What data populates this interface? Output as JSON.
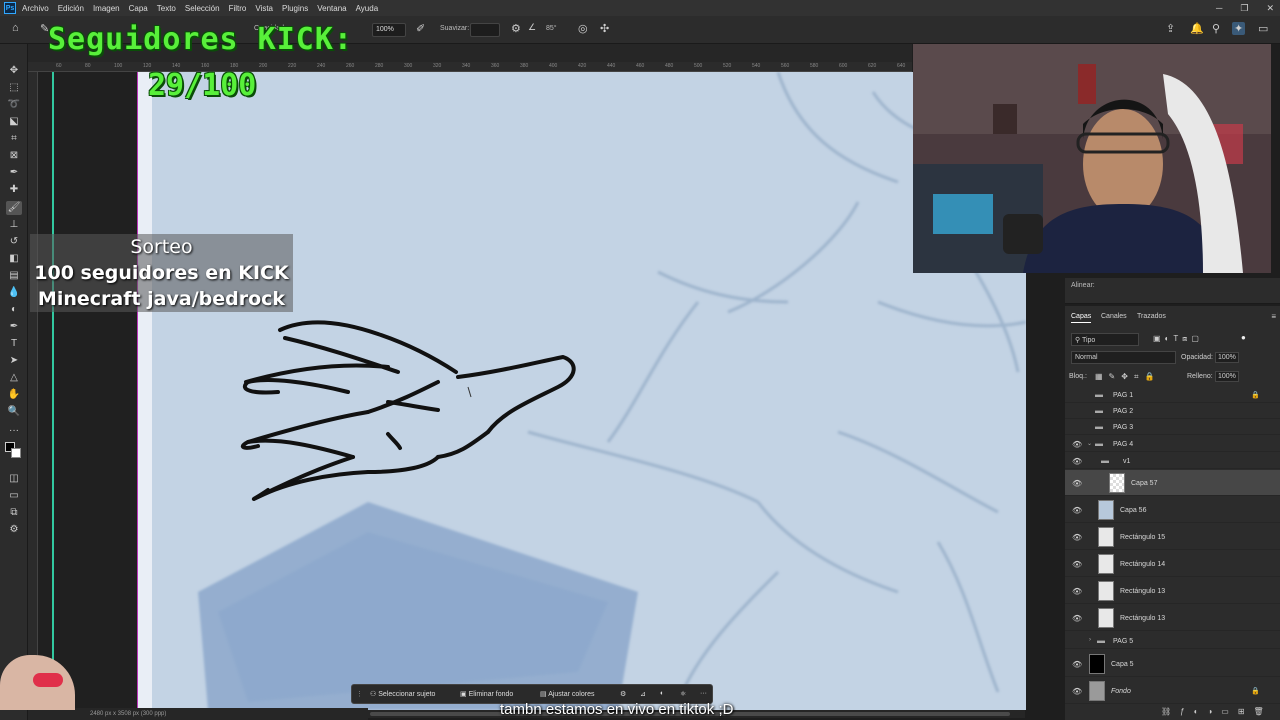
{
  "menubar": {
    "app_icon": "Ps",
    "items": [
      "Archivo",
      "Edición",
      "Imagen",
      "Capa",
      "Texto",
      "Selección",
      "Filtro",
      "Vista",
      "Plugins",
      "Ventana",
      "Ayuda"
    ]
  },
  "options": {
    "zoom": "100%",
    "smoothing_label": "Suavizar:",
    "angle": "85°",
    "opacity_label": "Opacidad:"
  },
  "overlay": {
    "kick_title": "Seguidores KICK:",
    "kick_count": "29/100",
    "giveaway_line1": "Sorteo",
    "giveaway_line2": "100 seguidores en KICK",
    "giveaway_line3": "Minecraft java/bedrock",
    "tiktok_caption": "tambn estamos en vivo en tiktok ;D"
  },
  "ruler": {
    "ticks": [
      "60",
      "80",
      "100",
      "120",
      "140",
      "160",
      "180",
      "200",
      "220",
      "240",
      "260",
      "280",
      "300",
      "320",
      "340",
      "360",
      "380",
      "400",
      "420",
      "440",
      "460",
      "480",
      "500",
      "520",
      "540",
      "560",
      "580",
      "600",
      "620",
      "640"
    ]
  },
  "panels": {
    "align_label": "Alinear:",
    "tabs": [
      "Capas",
      "Canales",
      "Trazados"
    ],
    "filter_kind": "Tipo",
    "blend_mode": "Normal",
    "opacity_label": "Opacidad:",
    "opacity_value": "100%",
    "lock_label": "Bloq.:",
    "fill_label": "Relleno:",
    "fill_value": "100%"
  },
  "layers": [
    {
      "name": "PAG 1",
      "kind": "group",
      "visible": false,
      "locked": true
    },
    {
      "name": "PAG 2",
      "kind": "group",
      "visible": false
    },
    {
      "name": "PAG 3",
      "kind": "group",
      "visible": false
    },
    {
      "name": "PAG 4",
      "kind": "group",
      "visible": true,
      "expanded": true
    },
    {
      "name": "v1",
      "kind": "subgroup",
      "visible": true
    },
    {
      "name": "Capa 57",
      "kind": "layer",
      "visible": true,
      "selected": true
    },
    {
      "name": "Capa 56",
      "kind": "layer",
      "visible": true
    },
    {
      "name": "Rectángulo 15",
      "kind": "layer",
      "visible": true
    },
    {
      "name": "Rectángulo 14",
      "kind": "layer",
      "visible": true
    },
    {
      "name": "Rectángulo 13",
      "kind": "layer",
      "visible": true
    },
    {
      "name": "Rectángulo 13",
      "kind": "layer",
      "visible": true
    },
    {
      "name": "PAG 5",
      "kind": "group",
      "visible": false
    },
    {
      "name": "Capa 5",
      "kind": "layer",
      "visible": true
    },
    {
      "name": "Fondo",
      "kind": "layer",
      "visible": true,
      "locked": true
    }
  ],
  "taskbar": {
    "select_subject": "Seleccionar sujeto",
    "remove_bg": "Eliminar fondo",
    "adjust_colors": "Ajustar colores"
  },
  "status": {
    "doc_size": "2480 px x 3508 px (300 ppp)"
  },
  "colors": {
    "kick_green": "#58f03a",
    "canvas_paper": "#c3d3e4",
    "panel_bg": "#2c2c2c"
  }
}
